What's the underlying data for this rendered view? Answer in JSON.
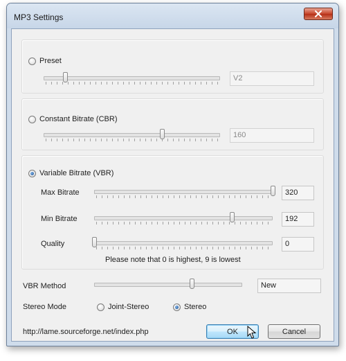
{
  "window": {
    "title": "MP3 Settings"
  },
  "preset": {
    "label": "Preset",
    "checked": false,
    "slider_fraction": 0.12,
    "value": "V2"
  },
  "cbr": {
    "label": "Constant Bitrate (CBR)",
    "checked": false,
    "slider_fraction": 0.67,
    "value": "160"
  },
  "vbr": {
    "label": "Variable Bitrate (VBR)",
    "checked": true,
    "max": {
      "label": "Max Bitrate",
      "slider_fraction": 1.0,
      "value": "320"
    },
    "min": {
      "label": "Min Bitrate",
      "slider_fraction": 0.77,
      "value": "192"
    },
    "quality": {
      "label": "Quality",
      "slider_fraction": 0.0,
      "value": "0"
    },
    "note": "Please note that 0 is highest, 9 is lowest"
  },
  "vbr_method": {
    "label": "VBR Method",
    "slider_fraction": 0.66,
    "value": "New"
  },
  "stereo_mode": {
    "label": "Stereo Mode",
    "options": [
      "Joint-Stereo",
      "Stereo"
    ],
    "selected": "Stereo"
  },
  "footer": {
    "url": "http://lame.sourceforge.net/index.php",
    "ok_label": "OK",
    "cancel_label": "Cancel"
  },
  "colors": {
    "window_frame": "#cfdceb",
    "close_button": "#c7452b",
    "default_button": "#bee6fd"
  }
}
